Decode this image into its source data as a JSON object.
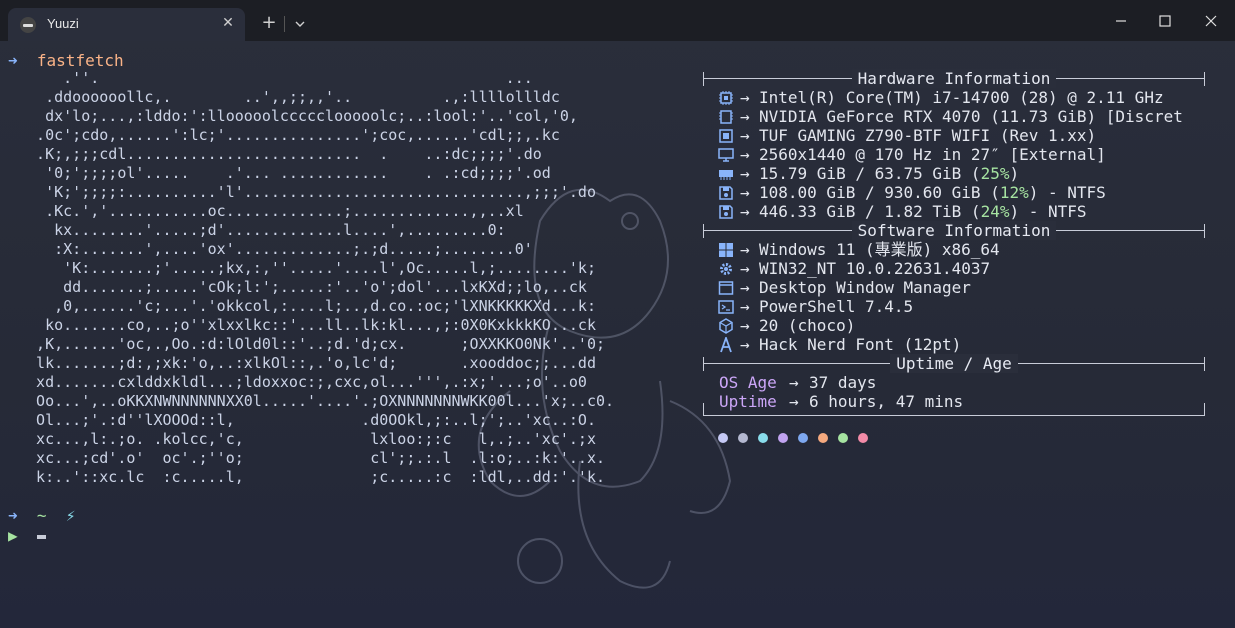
{
  "tab": {
    "title": "Yuuzi",
    "close": "✕",
    "new": "+"
  },
  "terminal": {
    "prompt_arrow": "➜",
    "command": "fastfetch",
    "prompt2_dir": "~",
    "prompt2_icon": "⚡",
    "prompt3": "▶"
  },
  "logo_lines": [
    "     .''.                                             ...",
    "   .ddoooooollc,.        ..',,;;,,'..          .,:llllollldc",
    "   dx'lo;...,:lddo:':llooooolccccclooooolc;..:lool:'..'col,'0,",
    "  .0c';cdo,......':lc;'...............';coc,......'cdl;;,.kc",
    "  .K;,;;;cdl..........................  .    ..:dc;;;;'.do",
    "   '0;';;;;ol'.....    .'... ............    . .:cd;;;;'.od",
    "   'K;';;;;:..........'l'...............................,;;;'.do",
    "   .Kc.','...........oc.............;.............,,..xl",
    "    kx........'.....;d'.............l....',.........0:",
    "    :X:.......',....'ox'.............;.;d.....;........0'",
    "     'K:.......;'.....;kx,:,''.....'....l',Oc.....l,;........'k;",
    "     dd.......;.....'cOk;l:';.....:'..'o';dol'...lxKXd;;lo,..ck",
    "    ,0,......'c;...'.'okkcol,:....l;..,d.co.:oc;'lXNKKKKKXd...k:",
    "   ko.......co,..;o''xlxxlkc::'...ll..lk:kl...,;:0X0KxkkkKO...ck",
    "  ,K,......'oc,.,Oo.:d:lOld0l::'..;d.'d;cx.      ;OXXKKO0Nk'..'0;",
    "  lk.......;d:,;xk:'o,..:xlkOl::,.'o,lc'd;       .xooddoc;;...dd",
    "  xd.......cxlddxkldl...;ldoxxoc:;,cxc,ol...''',.:x;'...;o'..o0",
    "  Oo...',..oKKXNWNNNNNNXX0l.....'....'.;OXNNNNNNNWKK00l...'x;..c0.",
    "  Ol...;'.:d''lXOOOd::l,              .d0OOkl,;:..l;';..'xc..:O.",
    "  xc...,l:.;o. .kolcc,'c,              lxloo:;:c   l,.;..'xc'.;x",
    "  xc...;cd'.o'  oc'.;''o;              cl';;.:.l  .l:o;..:k:'..x.",
    "  k:..'::xc.lc  :c.....l,              ;c.....:c  :ldl,..dd:'.'k."
  ],
  "hardware": {
    "title": "Hardware Information",
    "rows": [
      {
        "icon": "cpu-icon",
        "value": "Intel(R) Core(TM) i7-14700 (28) @ 2.11 GHz"
      },
      {
        "icon": "gpu-icon",
        "value": "NVIDIA GeForce RTX 4070 (11.73 GiB) [Discret"
      },
      {
        "icon": "motherboard-icon",
        "value": "TUF GAMING Z790-BTF WIFI (Rev 1.xx)"
      },
      {
        "icon": "monitor-icon",
        "value": "2560x1440 @ 170 Hz in 27″ [External]"
      },
      {
        "icon": "memory-icon",
        "value_pre": "15.79 GiB / 63.75 GiB (",
        "pct": "25%",
        "value_post": ")"
      },
      {
        "icon": "disk-icon",
        "value_pre": "108.00 GiB / 930.60 GiB (",
        "pct": "12%",
        "value_post": ") - NTFS"
      },
      {
        "icon": "disk-icon",
        "value_pre": "446.33 GiB / 1.82 TiB (",
        "pct": "24%",
        "value_post": ") - NTFS"
      }
    ]
  },
  "software": {
    "title": "Software Information",
    "rows": [
      {
        "icon": "windows-icon",
        "value": "Windows 11 (專業版) x86_64"
      },
      {
        "icon": "gear-icon",
        "value": "WIN32_NT 10.0.22631.4037"
      },
      {
        "icon": "window-icon",
        "value": "Desktop Window Manager"
      },
      {
        "icon": "terminal-icon",
        "value": "PowerShell 7.4.5"
      },
      {
        "icon": "package-icon",
        "value": "20 (choco)"
      },
      {
        "icon": "font-icon",
        "value": "Hack Nerd Font (12pt)"
      }
    ]
  },
  "uptime": {
    "title": "Uptime / Age",
    "rows": [
      {
        "label": "OS Age",
        "value": "37 days"
      },
      {
        "label": "Uptime",
        "value": "6 hours, 47 mins"
      }
    ]
  },
  "arrow": "→",
  "palette": [
    "#c5c9f5",
    "#b4b8d0",
    "#89dceb",
    "#c1a3f0",
    "#7ea8f0",
    "#f5a97f",
    "#a6e3a1",
    "#f38ba8"
  ],
  "colors": {
    "accent": "#89b4fa",
    "command": "#fab387",
    "green": "#a6e3a1",
    "purple": "#cba6f7",
    "pink": "#f38ba8"
  }
}
